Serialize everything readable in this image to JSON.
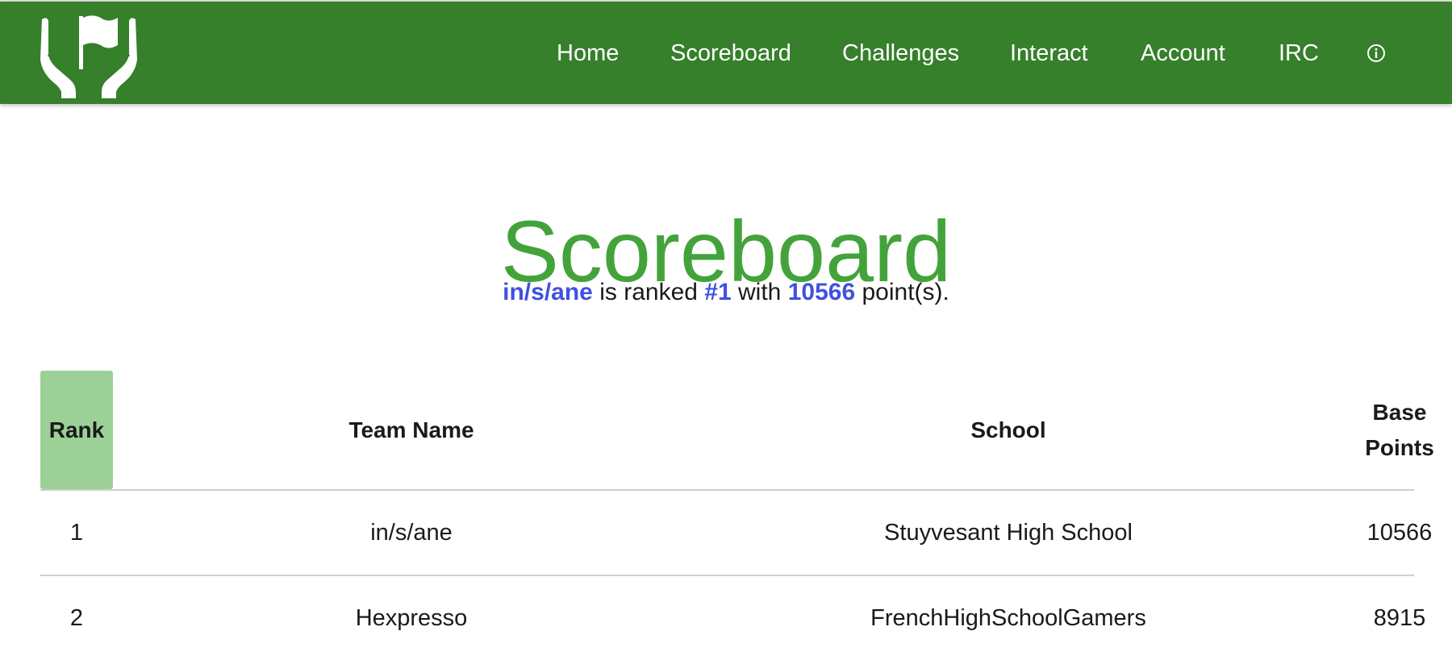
{
  "nav": {
    "logo_icon": "hands-holding-flag-icon",
    "items": [
      {
        "label": "Home"
      },
      {
        "label": "Scoreboard"
      },
      {
        "label": "Challenges"
      },
      {
        "label": "Interact"
      },
      {
        "label": "Account"
      },
      {
        "label": "IRC"
      }
    ],
    "info_icon": "info-circle-icon"
  },
  "page": {
    "title": "Scoreboard"
  },
  "summary": {
    "team": "in/s/ane",
    "text_ranked": "is ranked",
    "rank": "#1",
    "text_with": "with",
    "points": "10566",
    "text_points": "point(s)."
  },
  "table": {
    "headers": {
      "rank": "Rank",
      "team": "Team Name",
      "school": "School",
      "points_line1": "Base",
      "points_line2": "Points"
    },
    "rows": [
      {
        "rank": "1",
        "team": "in/s/ane",
        "school": "Stuyvesant High School",
        "points": "10566"
      },
      {
        "rank": "2",
        "team": "Hexpresso",
        "school": "FrenchHighSchoolGamers",
        "points": "8915"
      }
    ]
  },
  "colors": {
    "navbar": "#367f2b",
    "title": "#43a33a",
    "highlight": "#3f51e0",
    "rank_header": "#9bd196"
  }
}
